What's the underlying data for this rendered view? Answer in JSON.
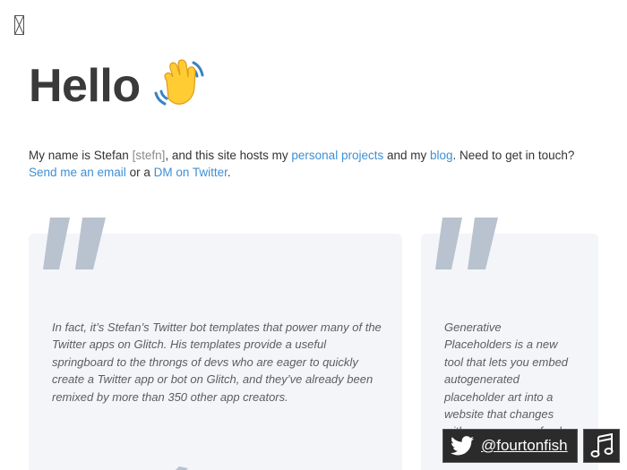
{
  "header": {
    "title": "Hello",
    "emoji_icon": "waving-hand-icon"
  },
  "intro": {
    "t1": "My name is Stefan ",
    "pronunciation": "[stefn]",
    "t2": ", and this site hosts my ",
    "link_projects": "personal projects",
    "t3": " and my ",
    "link_blog": "blog",
    "t4": ". Need to get in touch? ",
    "link_email": "Send me an email",
    "t5": " or a ",
    "link_twitter": "DM on Twitter",
    "t6": "."
  },
  "testimonials": [
    {
      "quote": "In fact, it’s Stefan’s Twitter bot templates that power many of the Twitter apps on Glitch. His templates provide a useful springboard to the throngs of devs who are eager to quickly create a Twitter app or bot on Glitch, and they’ve already been remixed by more than 350 other app creators."
    },
    {
      "quote": "Generative Placeholders is a new tool that lets you embed autogenerated placeholder art into a website that changes with every page refresh."
    }
  ],
  "footer": {
    "twitter_handle": "@fourtonfish",
    "twitter_icon": "twitter-bird-icon",
    "music_icon": "music-note-icon"
  },
  "colors": {
    "link": "#3f8fd4",
    "card_bg": "#f3f5f9",
    "quote_mark": "#b9c2cf"
  }
}
